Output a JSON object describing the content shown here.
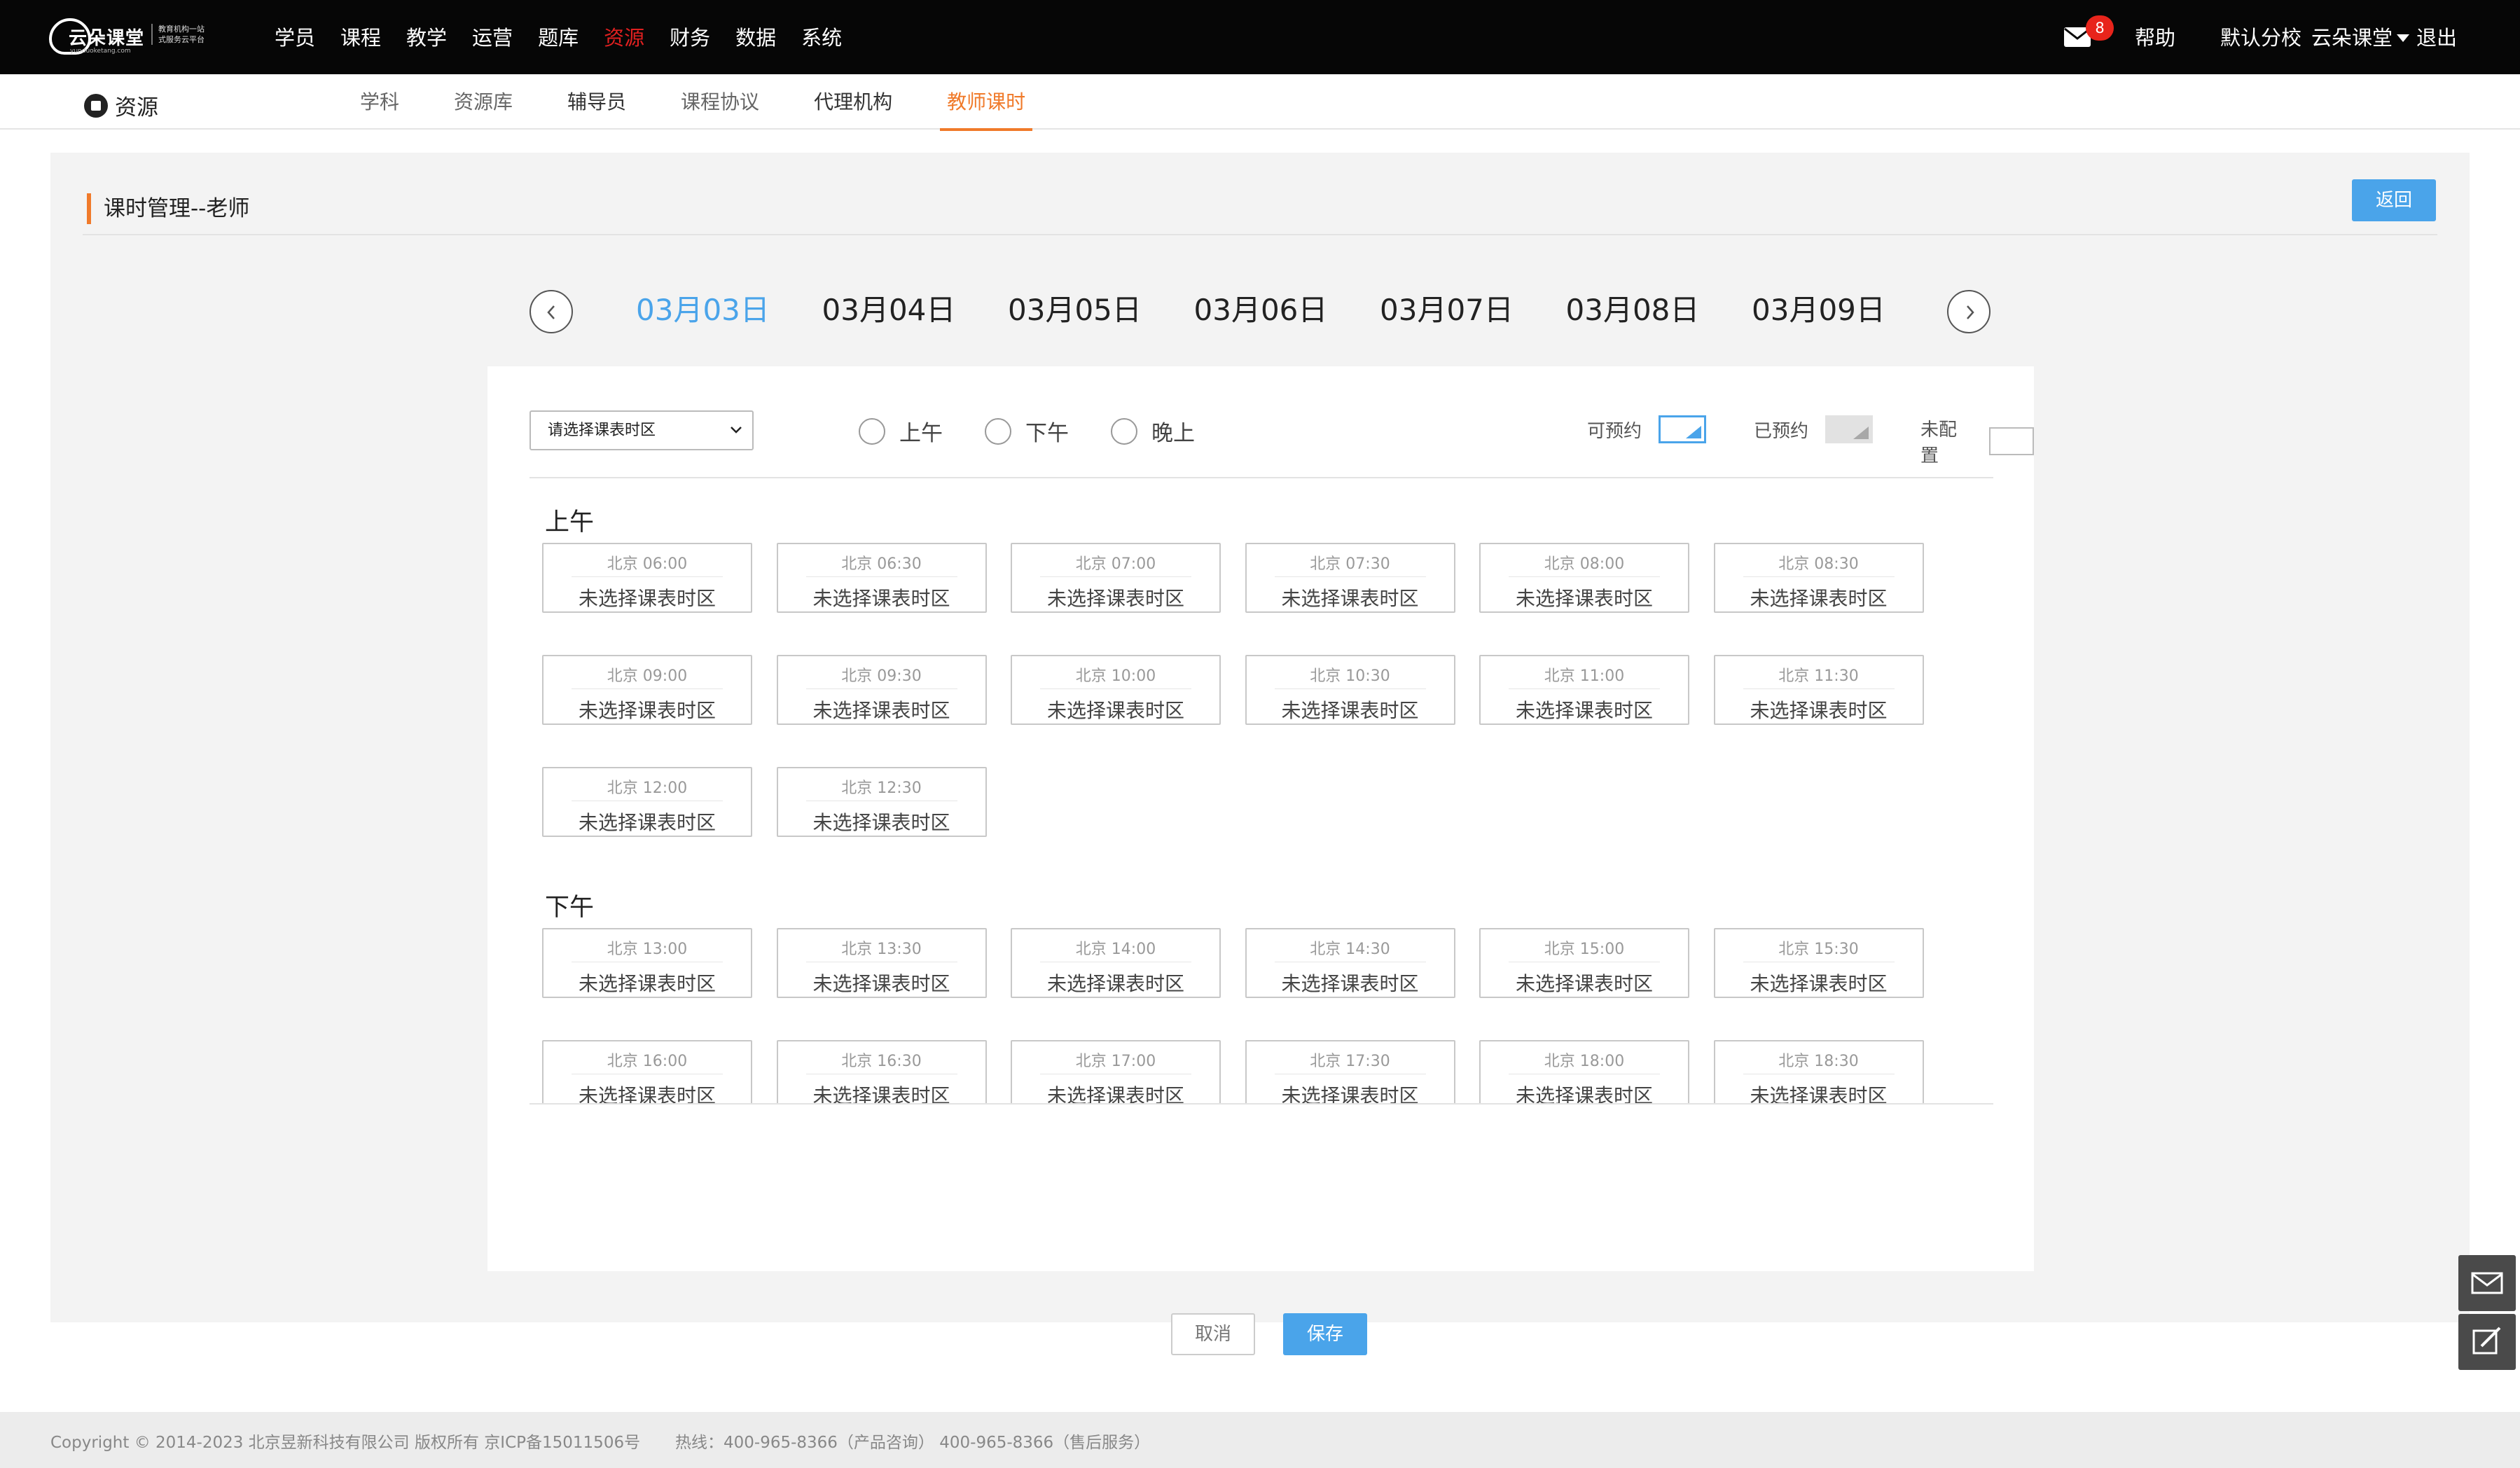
{
  "header": {
    "logo": {
      "brand": "云朵课堂",
      "tagline_line1": "教育机构一站",
      "tagline_line2": "式服务云平台",
      "url": "yunduoketang.com"
    },
    "nav": [
      {
        "label": "学员",
        "name": "nav-students"
      },
      {
        "label": "课程",
        "name": "nav-courses"
      },
      {
        "label": "教学",
        "name": "nav-teaching"
      },
      {
        "label": "运营",
        "name": "nav-operations"
      },
      {
        "label": "题库",
        "name": "nav-question-bank"
      },
      {
        "label": "资源",
        "name": "nav-resources"
      },
      {
        "label": "财务",
        "name": "nav-finance"
      },
      {
        "label": "数据",
        "name": "nav-data"
      },
      {
        "label": "系统",
        "name": "nav-system"
      }
    ],
    "active_nav": "资源",
    "mail_badge": "8",
    "help": "帮助",
    "branch": "默认分校",
    "user": "云朵课堂",
    "logout": "退出"
  },
  "subnav": {
    "section": "资源",
    "tabs": [
      {
        "label": "学科",
        "name": "tab-subjects"
      },
      {
        "label": "资源库",
        "name": "tab-resource-library"
      },
      {
        "label": "辅导员",
        "name": "tab-tutors"
      },
      {
        "label": "课程协议",
        "name": "tab-course-agreement"
      },
      {
        "label": "代理机构",
        "name": "tab-agencies"
      },
      {
        "label": "教师课时",
        "name": "tab-teacher-hours"
      }
    ],
    "active_tab": "教师课时"
  },
  "panel": {
    "title": "课时管理--老师",
    "back": "返回"
  },
  "dates": [
    "03月03日",
    "03月04日",
    "03月05日",
    "03月06日",
    "03月07日",
    "03月08日",
    "03月09日"
  ],
  "active_date": "03月03日",
  "filter": {
    "timezone_select": "请选择课表时区",
    "radios": [
      "上午",
      "下午",
      "晚上"
    ]
  },
  "legend": {
    "available": "可预约",
    "booked": "已预约",
    "unconfigured": "未配置"
  },
  "periods": [
    {
      "label": "上午",
      "slots": [
        {
          "time": "北京 06:00",
          "label": "未选择课表时区"
        },
        {
          "time": "北京 06:30",
          "label": "未选择课表时区"
        },
        {
          "time": "北京 07:00",
          "label": "未选择课表时区"
        },
        {
          "time": "北京 07:30",
          "label": "未选择课表时区"
        },
        {
          "time": "北京 08:00",
          "label": "未选择课表时区"
        },
        {
          "time": "北京 08:30",
          "label": "未选择课表时区"
        },
        {
          "time": "北京 09:00",
          "label": "未选择课表时区"
        },
        {
          "time": "北京 09:30",
          "label": "未选择课表时区"
        },
        {
          "time": "北京 10:00",
          "label": "未选择课表时区"
        },
        {
          "time": "北京 10:30",
          "label": "未选择课表时区"
        },
        {
          "time": "北京 11:00",
          "label": "未选择课表时区"
        },
        {
          "time": "北京 11:30",
          "label": "未选择课表时区"
        },
        {
          "time": "北京 12:00",
          "label": "未选择课表时区"
        },
        {
          "time": "北京 12:30",
          "label": "未选择课表时区"
        }
      ]
    },
    {
      "label": "下午",
      "slots": [
        {
          "time": "北京 13:00",
          "label": "未选择课表时区"
        },
        {
          "time": "北京 13:30",
          "label": "未选择课表时区"
        },
        {
          "time": "北京 14:00",
          "label": "未选择课表时区"
        },
        {
          "time": "北京 14:30",
          "label": "未选择课表时区"
        },
        {
          "time": "北京 15:00",
          "label": "未选择课表时区"
        },
        {
          "time": "北京 15:30",
          "label": "未选择课表时区"
        },
        {
          "time": "北京 16:00",
          "label": "未选择课表时区"
        },
        {
          "time": "北京 16:30",
          "label": "未选择课表时区"
        },
        {
          "time": "北京 17:00",
          "label": "未选择课表时区"
        },
        {
          "time": "北京 17:30",
          "label": "未选择课表时区"
        },
        {
          "time": "北京 18:00",
          "label": "未选择课表时区"
        },
        {
          "time": "北京 18:30",
          "label": "未选择课表时区"
        }
      ]
    }
  ],
  "actions": {
    "cancel": "取消",
    "save": "保存"
  },
  "floating": {
    "icons": [
      "mail-icon",
      "edit-icon"
    ]
  },
  "footer": {
    "copyright": "Copyright © 2014-2023 北京昱新科技有限公司 版权所有 京ICP备15011506号",
    "hotline": "热线：400-965-8366（产品咨询） 400-965-8366（售后服务）"
  },
  "colors": {
    "accent": "#4aa4ea",
    "active_tab": "#f07a2a",
    "active_nav": "#e02020",
    "badge": "#e8241b"
  }
}
